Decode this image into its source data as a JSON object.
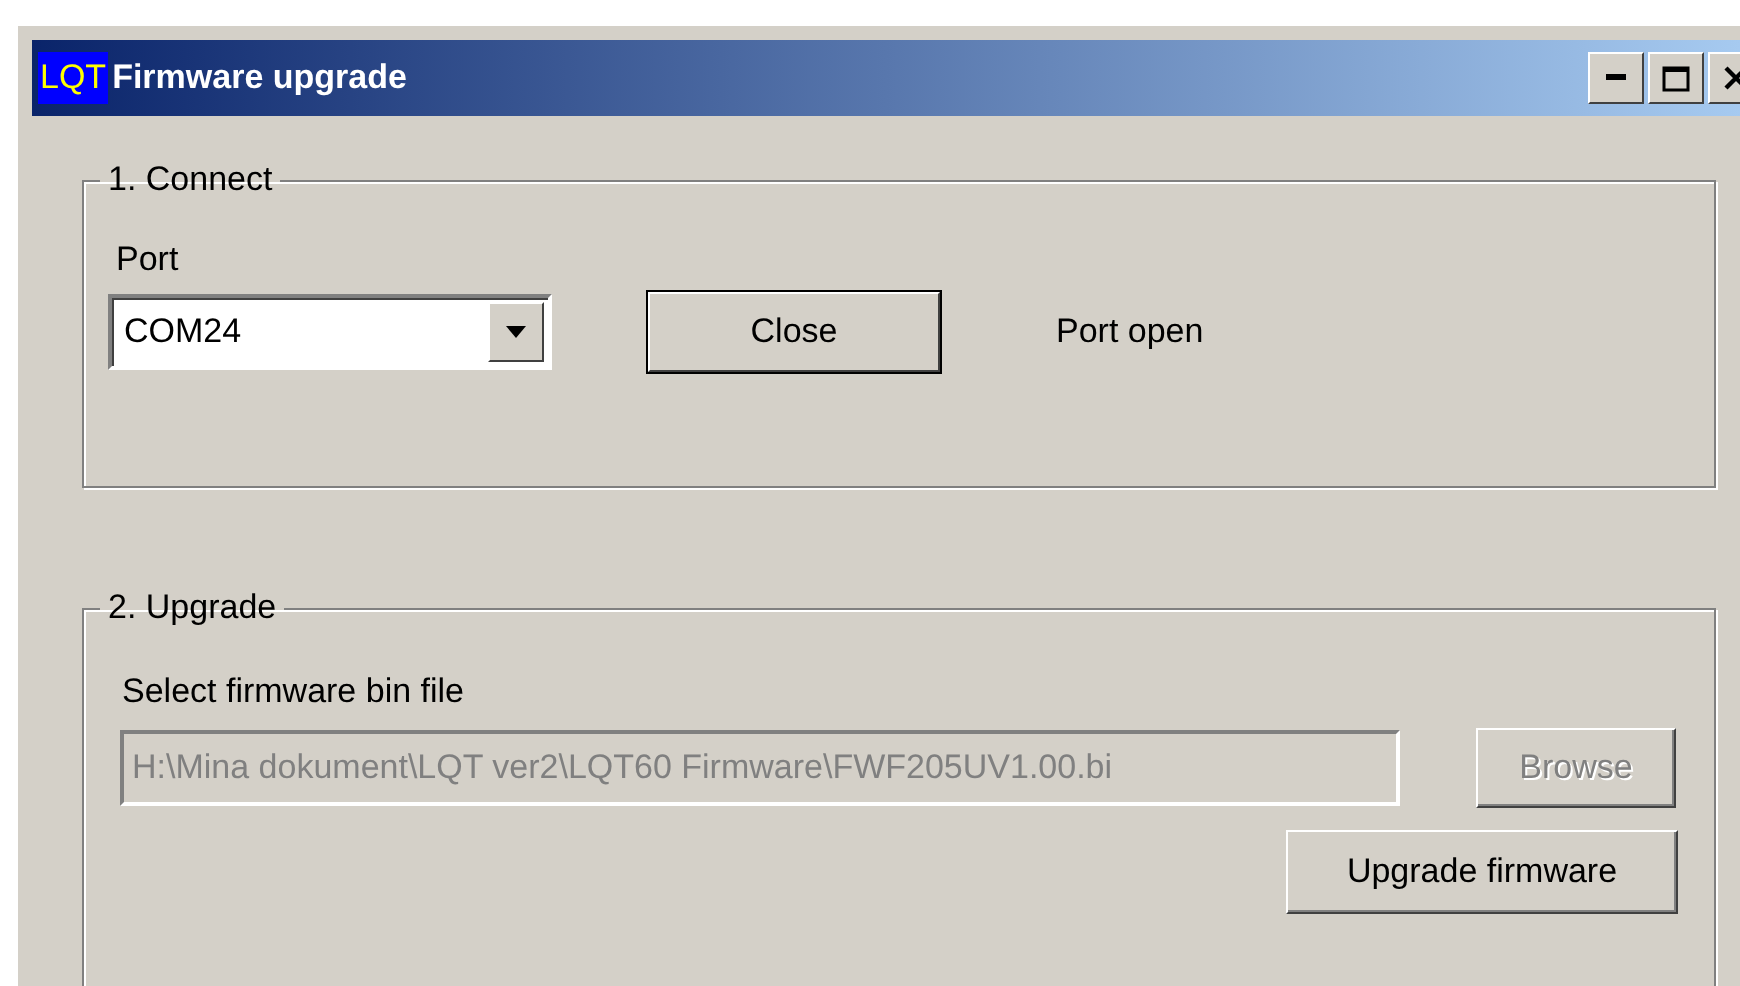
{
  "window": {
    "icon_text": "LQT",
    "title": "Firmware upgrade"
  },
  "connect": {
    "title": "1. Connect",
    "port_label": "Port",
    "port_value": "COM24",
    "button": {
      "label": "Close",
      "disabled": false
    },
    "status": "Port open"
  },
  "upgrade": {
    "title": "2. Upgrade",
    "file_label": "Select firmware bin file",
    "file_value": "H:\\Mina dokument\\LQT ver2\\LQT60 Firmware\\FWF205UV1.00.bi",
    "file_disabled": true,
    "browse": {
      "label": "Browse",
      "disabled": true
    },
    "upgrade_button": {
      "label": "Upgrade firmware",
      "disabled": false
    }
  }
}
